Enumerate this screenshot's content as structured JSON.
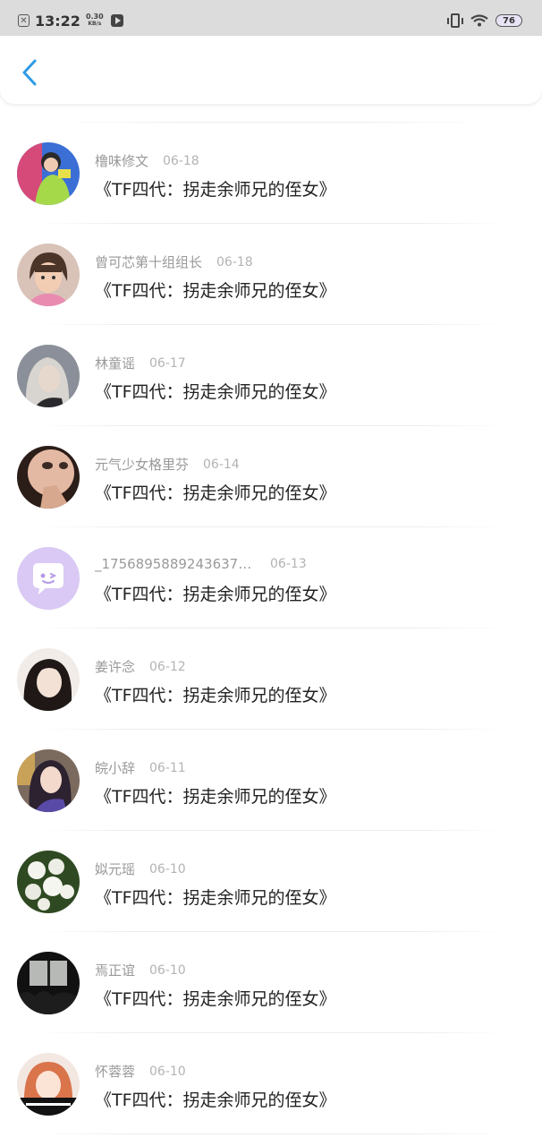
{
  "status_bar": {
    "time": "13:22",
    "speed_value": "0.30",
    "speed_unit": "KB/s",
    "battery": "76"
  },
  "nav": {
    "back_icon": "chevron-left-icon",
    "accent": "#2d9be6"
  },
  "items": [
    {
      "name": "橹味修文",
      "date": "06-18",
      "title": "《TF四代：拐走余师兄的侄女》",
      "avatar": "photo-green"
    },
    {
      "name": "曾可芯第十组组长",
      "date": "06-18",
      "title": "《TF四代：拐走余师兄的侄女》",
      "avatar": "photo-girl"
    },
    {
      "name": "林童谣",
      "date": "06-17",
      "title": "《TF四代：拐走余师兄的侄女》",
      "avatar": "photo-gray"
    },
    {
      "name": "元气少女格里芬",
      "date": "06-14",
      "title": "《TF四代：拐走余师兄的侄女》",
      "avatar": "photo-face"
    },
    {
      "name": "_17568958892436370...",
      "date": "06-13",
      "title": "《TF四代：拐走余师兄的侄女》",
      "avatar": "default-chat-avatar"
    },
    {
      "name": "姜许念",
      "date": "06-12",
      "title": "《TF四代：拐走余师兄的侄女》",
      "avatar": "photo-dark"
    },
    {
      "name": "皖小辞",
      "date": "06-11",
      "title": "《TF四代：拐走余师兄的侄女》",
      "avatar": "photo-purple"
    },
    {
      "name": "姒元瑶",
      "date": "06-10",
      "title": "《TF四代：拐走余师兄的侄女》",
      "avatar": "photo-flowers"
    },
    {
      "name": "焉正谊",
      "date": "06-10",
      "title": "《TF四代：拐走余师兄的侄女》",
      "avatar": "photo-night"
    },
    {
      "name": "怀蓉蓉",
      "date": "06-10",
      "title": "《TF四代：拐走余师兄的侄女》",
      "avatar": "photo-peach"
    }
  ]
}
